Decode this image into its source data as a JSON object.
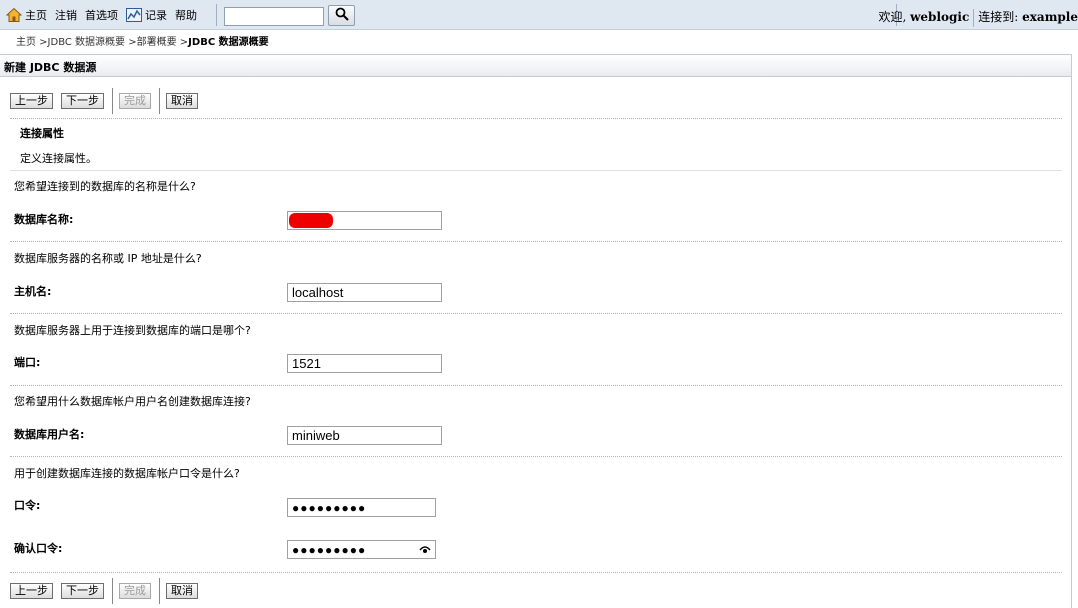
{
  "topbar": {
    "nav": [
      {
        "label": "主页",
        "icon": "home-icon"
      },
      {
        "label": "注销"
      },
      {
        "label": "首选项"
      },
      {
        "label": "记录",
        "icon": "chart-icon"
      },
      {
        "label": "帮助"
      }
    ],
    "search_value": "",
    "welcome_prefix": "欢迎, ",
    "welcome_user": "weblogic",
    "connected_prefix": "连接到: ",
    "connected_domain": "example"
  },
  "breadcrumb": {
    "path": "主页 >JDBC 数据源概要 >部署概要 >",
    "current": "JDBC 数据源概要"
  },
  "panel": {
    "title": "新建 JDBC 数据源"
  },
  "buttons": {
    "back": "上一步",
    "next": "下一步",
    "finish": "完成",
    "cancel": "取消"
  },
  "section": {
    "title": "连接属性",
    "description": "定义连接属性。"
  },
  "fields": [
    {
      "question": "您希望连接到的数据库的名称是什么?",
      "label": "数据库名称:",
      "value": ""
    },
    {
      "question": "数据库服务器的名称或 IP 地址是什么?",
      "label": "主机名:",
      "value": "localhost"
    },
    {
      "question": "数据库服务器上用于连接到数据库的端口是哪个?",
      "label": "端口:",
      "value": "1521"
    },
    {
      "question": "您希望用什么数据库帐户用户名创建数据库连接?",
      "label": "数据库用户名:",
      "value": "miniweb"
    }
  ],
  "password": {
    "question": "用于创建数据库连接的数据库帐户口令是什么?",
    "label": "口令:",
    "value": "●●●●●●●●●",
    "confirm_label": "确认口令:",
    "confirm_value": "●●●●●●●●●"
  },
  "colors": {
    "topbar_bg": "#dfe7f1",
    "redaction": "#ee0000"
  }
}
